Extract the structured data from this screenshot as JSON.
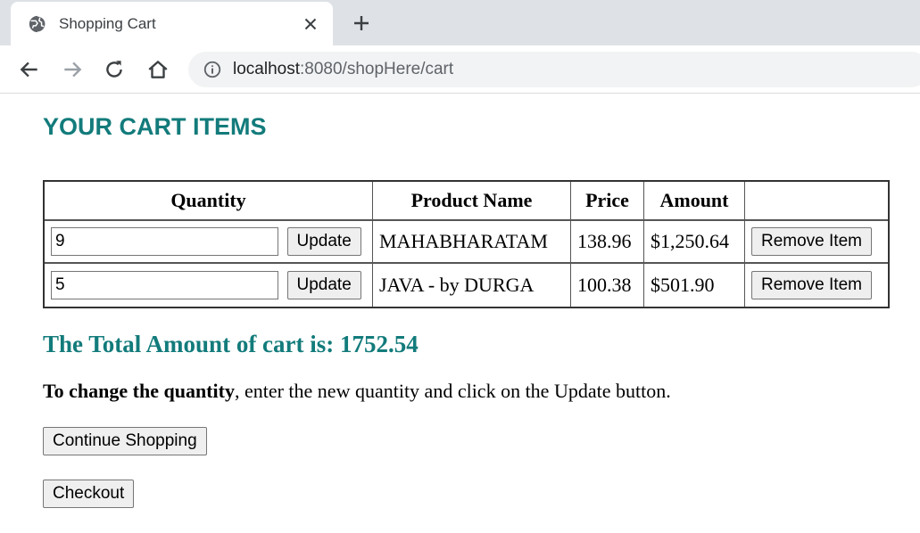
{
  "browser": {
    "tab_title": "Shopping Cart",
    "url_host": "localhost",
    "url_rest": ":8080/shopHere/cart"
  },
  "page": {
    "title": "YOUR CART ITEMS",
    "table": {
      "headers": [
        "Quantity",
        "Product Name",
        "Price",
        "Amount",
        ""
      ],
      "rows": [
        {
          "quantity": "9",
          "update_label": "Update",
          "product": "MAHABHARATAM",
          "price": "138.96",
          "amount": "$1,250.64",
          "remove_label": "Remove Item"
        },
        {
          "quantity": "5",
          "update_label": "Update",
          "product": "JAVA - by DURGA",
          "price": "100.38",
          "amount": "$501.90",
          "remove_label": "Remove Item"
        }
      ]
    },
    "total_text": "The Total Amount of cart is: 1752.54",
    "instruction_bold": "To change the quantity",
    "instruction_rest": ", enter the new quantity and click on the Update button.",
    "continue_label": "Continue Shopping",
    "checkout_label": "Checkout"
  },
  "colors": {
    "accent": "#137b7b",
    "chrome_bg": "#dee1e6",
    "omnibox_bg": "#f1f3f4"
  },
  "icons": {
    "favicon": "globe-icon",
    "close": "close-icon",
    "new_tab": "plus-icon",
    "back": "back-arrow-icon",
    "forward": "forward-arrow-icon",
    "reload": "reload-icon",
    "home": "home-icon",
    "info": "info-icon"
  }
}
